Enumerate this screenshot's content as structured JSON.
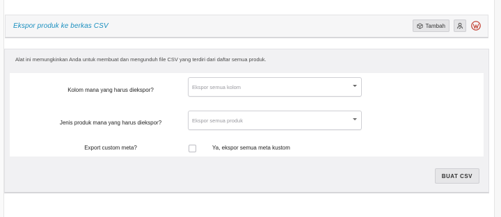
{
  "header": {
    "title": "Ekspor produk ke berkas CSV",
    "add_button_label": "Tambah",
    "icons": [
      "cube-icon",
      "person-icon",
      "wordpress-logo"
    ]
  },
  "main": {
    "intro": "Alat ini memungkinkan Anda untuk membuat dan mengunduh file CSV yang terdiri dari daftar semua produk.",
    "columns_label": "Kolom mana yang harus diekspor?",
    "columns_placeholder": "Ekspor semua kolom",
    "types_label": "Jenis produk mana yang harus diekspor?",
    "types_placeholder": "Ekspor semua produk",
    "meta_label": "Export custom meta?",
    "meta_checkbox_label": "Ya, ekspor semua meta kustom",
    "meta_checked": false,
    "generate_button": "BUAT CSV"
  },
  "colors": {
    "title_color": "#1a8fbf",
    "wp_red": "#c0392b"
  }
}
